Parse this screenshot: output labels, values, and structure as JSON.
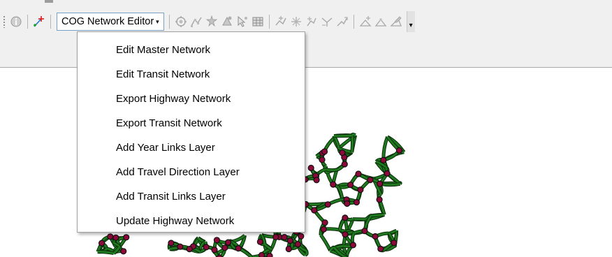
{
  "toolbar": {
    "network_editor_label": "COG Network Editor",
    "network_editor_caret": "▾",
    "overflow_glyph": "▾",
    "icons": [
      "identify-icon",
      "add-node-icon",
      "edit-tool-icon",
      "reshape-icon",
      "split-icon",
      "attributes-icon",
      "select-feature-icon",
      "table-icon",
      "add-link-icon",
      "delete-link-icon",
      "move-link-icon",
      "merge-link-icon",
      "trace-link-icon",
      "add-vertex-icon",
      "snap-icon",
      "measure-icon"
    ]
  },
  "menu": {
    "items": [
      {
        "label": "Edit Master Network"
      },
      {
        "label": "Edit Transit Network"
      },
      {
        "label": "Export Highway Network"
      },
      {
        "label": "Export Transit Network"
      },
      {
        "label": "Add Year Links Layer"
      },
      {
        "label": "Add Travel Direction Layer"
      },
      {
        "label": "Add Transit Links Layer"
      },
      {
        "label": "Update Highway Network"
      }
    ]
  },
  "colors": {
    "toolbar_bg": "#f0f0f0",
    "network_links": "#1f7a1f",
    "network_nodes": "#8b0a3a",
    "menu_border": "#a0a0a0",
    "button_border": "#7aa0c8"
  }
}
